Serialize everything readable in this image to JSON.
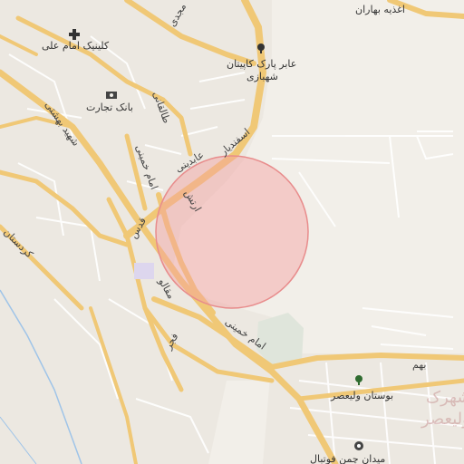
{
  "labels": {
    "clinic": "کلینیک امام علی",
    "bank": "بانک تجارت",
    "park": "عابر پارک کاپیتان",
    "park_line2": "شهبازی",
    "food": "اغذیه بهاران",
    "garden": "بوستان ولیعصر",
    "field": "میدان چمن فوتبال",
    "town_line1": "شهرک",
    "town_line2": "ولیعصر"
  },
  "roads": {
    "mahdi": "مجدی",
    "taleghani": "طالقانی",
    "shahid_beheshti": "شهید بهشتی",
    "imam_khomeini_n": "امام خمینی",
    "esfandiar": "اسفندیار",
    "abdi": "عابدینی",
    "artesh": "ارتش",
    "ghods": "قدس",
    "kordestan": "کردستان",
    "moghadam": "مقالو",
    "fajr": "فجر",
    "imam_khomeini_s": "امام خمینی",
    "bahman": "بهم"
  },
  "marker": {
    "type": "radius-circle",
    "color": "#f4a0a0"
  }
}
